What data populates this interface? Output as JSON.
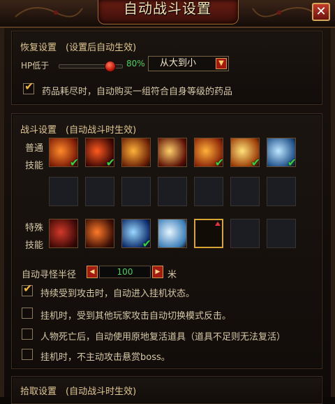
{
  "window": {
    "title": "自动战斗设置",
    "close_glyph": "✕"
  },
  "recovery": {
    "title": "恢复设置　(设置后自动生效)",
    "hp_label": "HP低于",
    "hp_percent": 0.8,
    "hp_percent_text": "80%",
    "order_value": "从大到小",
    "auto_buy_checked": true,
    "auto_buy_text": "药品耗尽时，自动购买一组符合自身等级的药品"
  },
  "combat": {
    "title": "战斗设置　(自动战斗时生效)",
    "normal_label_1": "普通",
    "normal_label_2": "技能",
    "special_label_1": "特殊",
    "special_label_2": "技能",
    "normal_skills_row1": [
      {
        "icon": "fire-slash-skill-icon",
        "checked": true,
        "c1": "#ff8a2b",
        "c2": "#7a1a06"
      },
      {
        "icon": "flame-strike-skill-icon",
        "checked": true,
        "c1": "#ff5a1f",
        "c2": "#3b0604"
      },
      {
        "icon": "demon-face-skill-icon",
        "checked": false,
        "c1": "#ffb23a",
        "c2": "#6a1f06"
      },
      {
        "icon": "fire-crescent-skill-icon",
        "checked": false,
        "c1": "#ffce6a",
        "c2": "#5a0f05"
      },
      {
        "icon": "fire-swirl-skill-icon",
        "checked": true,
        "c1": "#ffb23a",
        "c2": "#8a2208"
      },
      {
        "icon": "golden-burst-skill-icon",
        "checked": true,
        "c1": "#ffe27a",
        "c2": "#9a3a06"
      },
      {
        "icon": "ice-shard-skill-icon",
        "checked": true,
        "c1": "#bfe7ff",
        "c2": "#1e4f88"
      }
    ],
    "normal_skills_row2_empty": 7,
    "special_skills": [
      {
        "icon": "blood-rune-skill-icon",
        "checked": false,
        "c1": "#d23a2a",
        "c2": "#3b0805"
      },
      {
        "icon": "fire-beast-skill-icon",
        "checked": false,
        "c1": "#ff7a2a",
        "c2": "#3b0e05"
      },
      {
        "icon": "lightning-skill-icon",
        "checked": true,
        "c1": "#9ad8ff",
        "c2": "#0b2a6a"
      },
      {
        "icon": "frost-wave-skill-icon",
        "checked": false,
        "c1": "#e6f5ff",
        "c2": "#3a7db8"
      }
    ],
    "special_selected_slot": true,
    "special_empty_count": 2,
    "radius_label": "自动寻怪半径",
    "radius_value": "100",
    "radius_unit": "米",
    "options": [
      {
        "text": "持续受到攻击时，自动进入挂机状态。",
        "checked": true
      },
      {
        "text": "挂机时，受到其他玩家攻击自动切换模式反击。",
        "checked": false
      },
      {
        "text": "人物死亡后，自动使用原地复活道具（道具不足则无法复活）",
        "checked": false
      },
      {
        "text": "挂机时，不主动攻击悬赏boss。",
        "checked": false
      }
    ]
  },
  "pickup": {
    "title": "拾取设置　(自动战斗时生效)"
  }
}
